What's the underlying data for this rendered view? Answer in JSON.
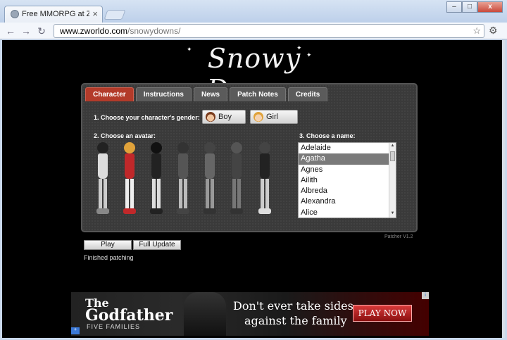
{
  "browser": {
    "tab_title": "Free MMORPG at Zworldo.c",
    "url_host": "www.zworldo.com",
    "url_path": "/snowydowns/"
  },
  "page": {
    "logo_text": "Snowy Downs",
    "tabs": [
      "Character",
      "Instructions",
      "News",
      "Patch Notes",
      "Credits"
    ],
    "gender_prompt": "1. Choose your character's gender:",
    "boy_label": "Boy",
    "girl_label": "Girl",
    "avatar_prompt": "2. Choose an avatar:",
    "name_prompt": "3. Choose a name:",
    "names": [
      "Adelaide",
      "Agatha",
      "Agnes",
      "Ailith",
      "Albreda",
      "Alexandra",
      "Alice"
    ],
    "selected_name": "Agatha",
    "patcher_version": "Patcher V1.2",
    "play_label": "Play",
    "full_update_label": "Full Update",
    "status_text": "Finished patching"
  },
  "ad": {
    "brand_top": "The",
    "brand_main": "Godfather",
    "brand_sub": "FIVE FAMILIES",
    "line1": "Don't ever take sides",
    "line2": "against the family",
    "cta": "PLAY NOW"
  },
  "colors": {
    "active_tab": "#b33b2a",
    "panel_bg": "#3a3a3a",
    "page_bg": "#000000"
  }
}
